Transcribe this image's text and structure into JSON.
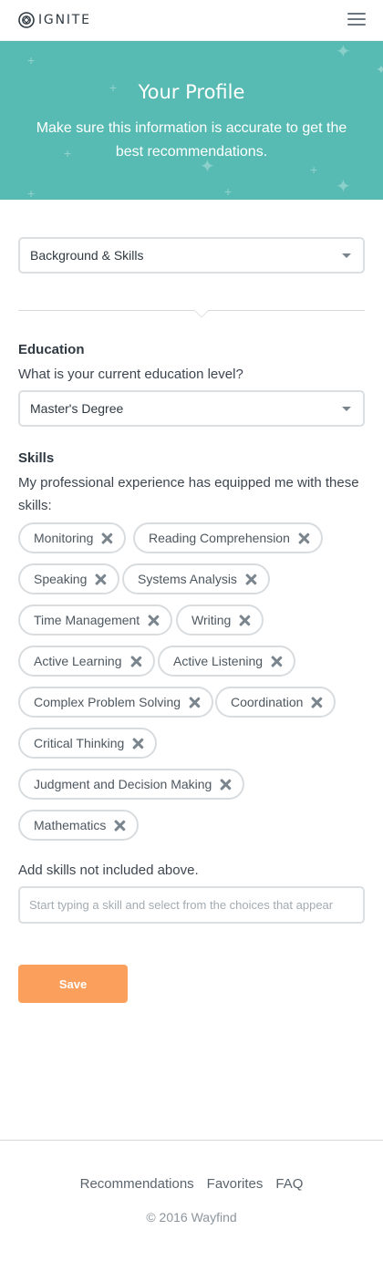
{
  "header": {
    "brand": "IGNITE",
    "logo_icon": "ignite-logo-icon",
    "menu_icon": "hamburger-menu-icon"
  },
  "hero": {
    "title": "Your Profile",
    "subtitle": "Make sure this information is accurate to get the best recommendations.",
    "background_color": "#58bbb3"
  },
  "section_select": {
    "value": "Background & Skills"
  },
  "education": {
    "heading": "Education",
    "question": "What is your current education level?",
    "value": "Master's Degree"
  },
  "skills": {
    "heading": "Skills",
    "description": "My professional experience has equipped me with these skills:",
    "items": [
      {
        "label": "Monitoring"
      },
      {
        "label": "Reading Comprehension"
      },
      {
        "label": "Speaking"
      },
      {
        "label": "Systems Analysis"
      },
      {
        "label": "Time Management"
      },
      {
        "label": "Writing"
      },
      {
        "label": "Active Learning"
      },
      {
        "label": "Active Listening"
      },
      {
        "label": "Complex Problem Solving"
      },
      {
        "label": "Coordination"
      },
      {
        "label": "Critical Thinking"
      },
      {
        "label": "Judgment and Decision Making"
      },
      {
        "label": "Mathematics"
      }
    ],
    "add_label": "Add skills not included above.",
    "input_placeholder": "Start typing a skill and select from the choices that appear",
    "input_value": ""
  },
  "actions": {
    "save_label": "Save",
    "save_color": "#fba05c"
  },
  "footer": {
    "links": [
      {
        "label": "Recommendations"
      },
      {
        "label": "Favorites"
      },
      {
        "label": "FAQ"
      }
    ],
    "copyright": "© 2016 Wayfind"
  }
}
